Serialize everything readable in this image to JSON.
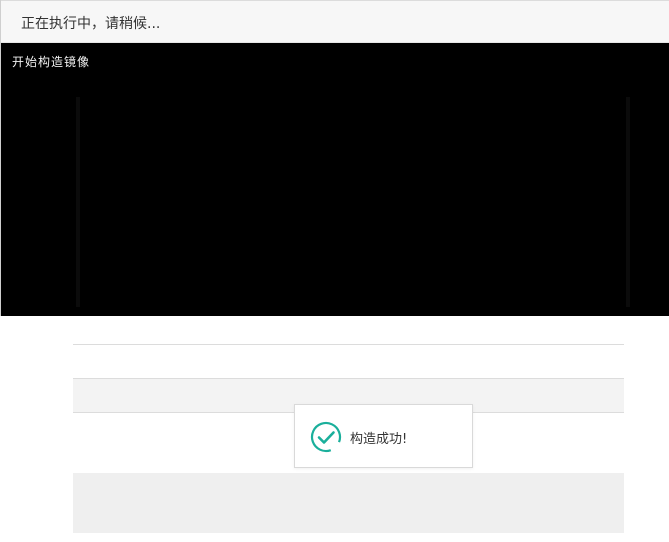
{
  "dialog": {
    "title": "正在执行中，请稍候...",
    "terminal_output": "开始构造镜像"
  },
  "toast": {
    "message": "构造成功!",
    "icon": "check-circle-icon",
    "accent_color": "#1AAF9B"
  }
}
